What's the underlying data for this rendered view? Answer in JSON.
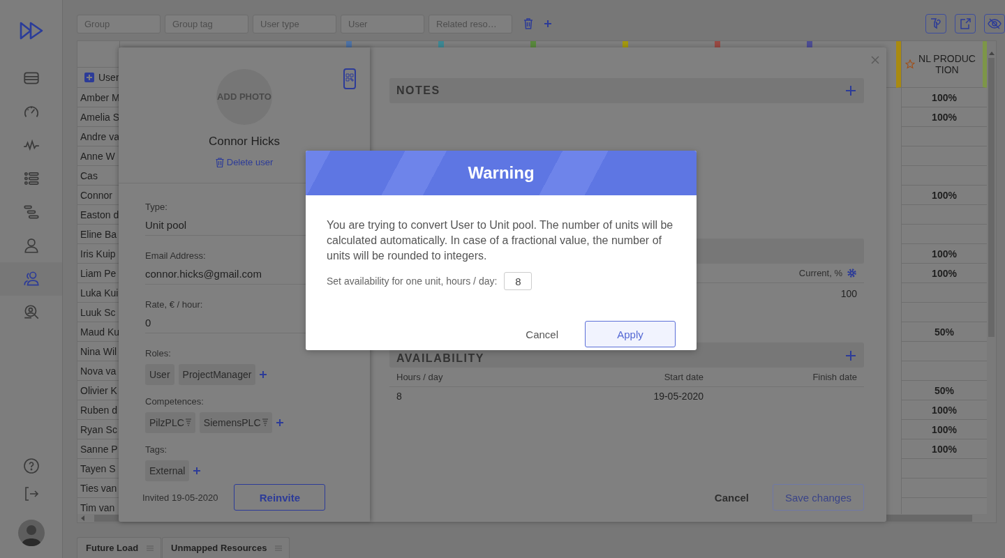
{
  "sidebar": {
    "items": [
      {
        "selected": false
      },
      {
        "selected": false
      },
      {
        "selected": false
      },
      {
        "selected": false
      },
      {
        "selected": false
      },
      {
        "selected": false
      },
      {
        "selected": true
      },
      {
        "selected": false
      }
    ]
  },
  "filters": [
    {
      "placeholder": "Group"
    },
    {
      "placeholder": "Group tag"
    },
    {
      "placeholder": "User type"
    },
    {
      "placeholder": "User"
    },
    {
      "placeholder": "Related reso…"
    }
  ],
  "table": {
    "user_column": "User",
    "load_column": "NL PRODUCTION",
    "markers": [
      {
        "color": "#4f74a8"
      },
      {
        "color": "#3e8a96"
      },
      {
        "color": "#5a8a3e"
      },
      {
        "color": "#a59a10"
      },
      {
        "color": "#9a4a44"
      },
      {
        "color": "#4e4e96"
      }
    ],
    "rows": [
      {
        "name": "Amber M",
        "load": "100%"
      },
      {
        "name": "Amelia S",
        "load": "100%"
      },
      {
        "name": "Andre va"
      },
      {
        "name": "Anne W"
      },
      {
        "name": "Cas"
      },
      {
        "name": "Connor",
        "load": "100%"
      },
      {
        "name": "Easton d"
      },
      {
        "name": "Eline Ba"
      },
      {
        "name": "Iris Kuip",
        "load": "100%"
      },
      {
        "name": "Liam Pe",
        "load": "100%"
      },
      {
        "name": "Luka Kui"
      },
      {
        "name": "Luuk Sc"
      },
      {
        "name": "Maud Ku",
        "load": "50%"
      },
      {
        "name": "Nina Wil"
      },
      {
        "name": "Nova va"
      },
      {
        "name": "Olivier K",
        "load": "50%"
      },
      {
        "name": "Ruben d",
        "load": "100%"
      },
      {
        "name": "Ryan Sc",
        "load": "100%"
      },
      {
        "name": "Sanne P",
        "load": "100%"
      },
      {
        "name": "Tayen S"
      },
      {
        "name": "Ties van"
      },
      {
        "name": "Tim van"
      }
    ]
  },
  "panel": {
    "photo_label": "ADD PHOTO",
    "name": "Connor Hicks",
    "delete_label": "Delete user",
    "fields": [
      {
        "label": "Type:",
        "value": "Unit pool"
      },
      {
        "label": "Email Address:",
        "value": "connor.hicks@gmail.com"
      },
      {
        "label": "Rate, € / hour:",
        "value": "0"
      }
    ],
    "chip_groups": [
      {
        "label": "Roles:",
        "kind": "plain",
        "chips": [
          "User",
          "ProjectManager"
        ]
      },
      {
        "label": "Competences:",
        "kind": "leveled",
        "chips": [
          "PilzPLC",
          "SiemensPLC"
        ]
      },
      {
        "label": "Tags:",
        "kind": "plain",
        "chips": [
          "External"
        ]
      }
    ],
    "invited": "Invited 19-05-2020",
    "reinvite": "Reinvite",
    "notes_title": "NOTES",
    "current": {
      "label": "Current, %",
      "value": "100"
    },
    "availability": {
      "title": "AVAILABILITY",
      "columns": [
        "Hours / day",
        "Start date",
        "Finish date"
      ],
      "rows": [
        [
          "8",
          "19-05-2020"
        ]
      ]
    },
    "cancel": "Cancel",
    "save": {
      "label": "Save changes",
      "disabled": true
    }
  },
  "dialog": {
    "title": "Warning",
    "message": "You are trying to convert User to Unit pool. The number of units will be calculated automatically. In case of a fractional value, the number of units will be rounded to integers.",
    "availability_label": "Set availability for one unit, hours / day:",
    "availability_value": "8",
    "cancel": "Cancel",
    "apply": "Apply"
  },
  "bottom_tabs": [
    {
      "label": "Future Load"
    },
    {
      "label": "Unmapped Resources"
    }
  ]
}
